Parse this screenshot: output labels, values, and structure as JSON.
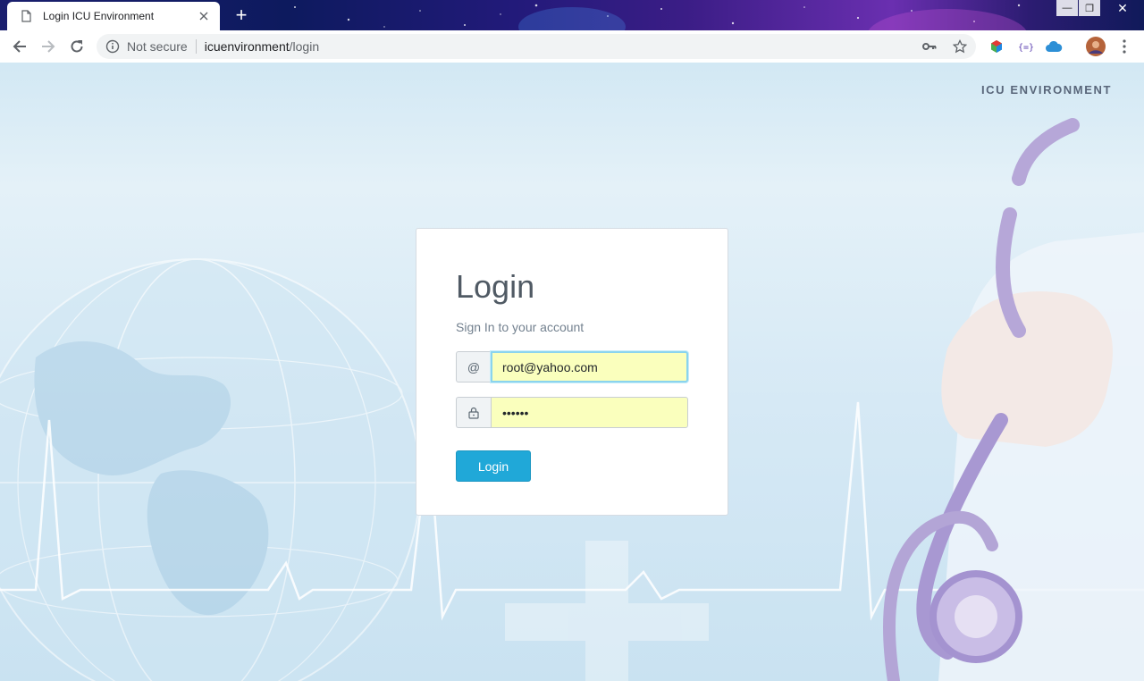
{
  "browser": {
    "tab_title": "Login ICU Environment",
    "new_tab_symbol": "+",
    "security_label": "Not secure",
    "url_host": "icuenvironment",
    "url_path": "/login",
    "window_controls": {
      "minimize": "—",
      "restore": "❐",
      "close": "✕"
    }
  },
  "brand": "ICU ENVIRONMENT",
  "login": {
    "title": "Login",
    "subtitle": "Sign In to your account",
    "email_addon": "@",
    "email_value": "root@yahoo.com",
    "password_value": "••••••",
    "button_label": "Login"
  },
  "colors": {
    "primary_button": "#20a8d8",
    "autofill_bg": "#faffbd",
    "brand_text": "#59667a"
  }
}
